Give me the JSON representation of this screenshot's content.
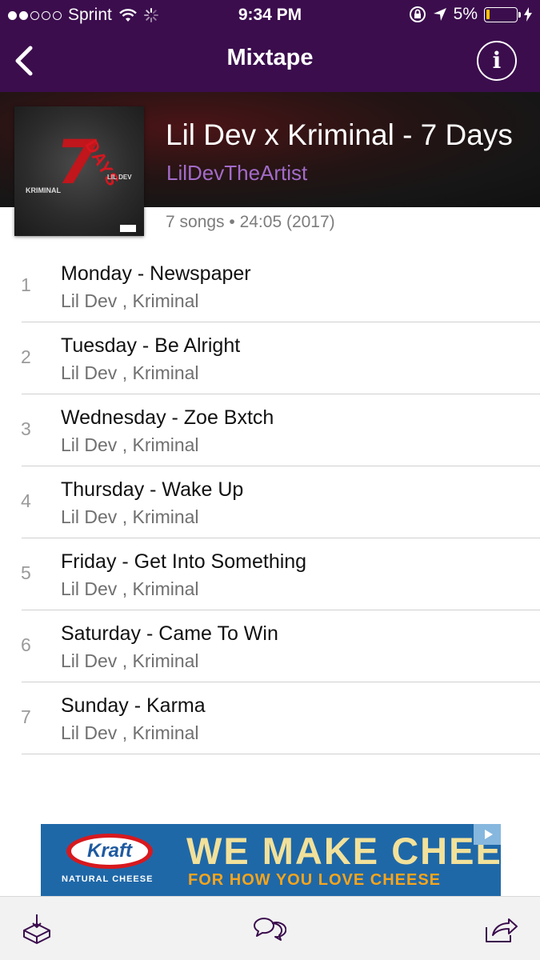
{
  "status_bar": {
    "carrier": "Sprint",
    "time": "9:34 PM",
    "battery": "5%"
  },
  "nav": {
    "title": "Mixtape",
    "back_icon": "chevron-left-icon",
    "info_label": "i"
  },
  "album": {
    "title": "Lil Dev x Kriminal - 7 Days",
    "artist": "LilDevTheArtist",
    "meta": "7 songs • 24:05 (2017)",
    "cover": {
      "big_number": "7",
      "word": "DAYS",
      "left_name": "KRIMINAL",
      "right_name": "LIL DEV"
    }
  },
  "songs": [
    {
      "num": "1",
      "title": "Monday - Newspaper",
      "artist": "Lil Dev , Kriminal"
    },
    {
      "num": "2",
      "title": "Tuesday - Be Alright",
      "artist": "Lil Dev , Kriminal"
    },
    {
      "num": "3",
      "title": "Wednesday - Zoe Bxtch",
      "artist": "Lil Dev , Kriminal"
    },
    {
      "num": "4",
      "title": "Thursday - Wake Up",
      "artist": "Lil Dev , Kriminal"
    },
    {
      "num": "5",
      "title": "Friday - Get Into Something",
      "artist": "Lil Dev , Kriminal"
    },
    {
      "num": "6",
      "title": "Saturday - Came To Win",
      "artist": "Lil Dev , Kriminal"
    },
    {
      "num": "7",
      "title": "Sunday - Karma",
      "artist": "Lil Dev , Kriminal"
    }
  ],
  "ad": {
    "brand": "Kraft",
    "brand_sub": "NATURAL CHEESE",
    "headline": "WE MAKE CHEESE",
    "tagline": "FOR HOW YOU LOVE CHEESE"
  },
  "toolbar": {
    "download_icon": "download-box-icon",
    "comments_icon": "chat-bubbles-icon",
    "share_icon": "share-icon"
  },
  "colors": {
    "nav_bg": "#3b0d4d",
    "artist_link": "#a36bc9",
    "ad_bg": "#1f68a8"
  }
}
